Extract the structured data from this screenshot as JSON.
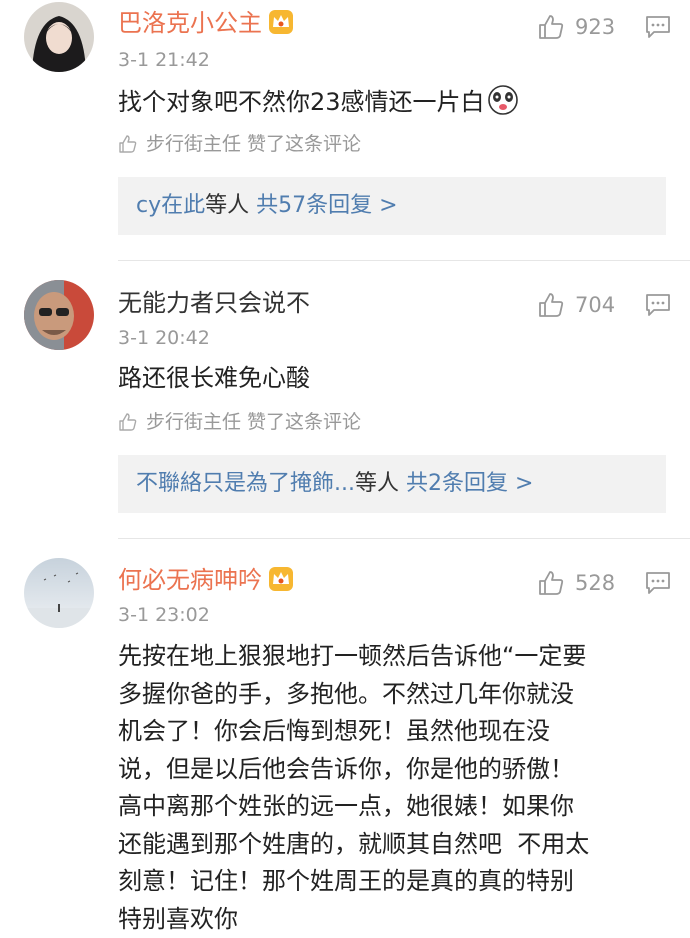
{
  "comments": [
    {
      "username": "巴洛克小公主",
      "vip": true,
      "time": "3-1 21:42",
      "text": "找个对象吧不然你23感情还一片白",
      "likes": "923",
      "liked_by": "步行街主任 赞了这条评论",
      "reply_user": "cy在此",
      "reply_mid": "等人",
      "reply_count": "共57条回复 >"
    },
    {
      "username": "无能力者只会说不",
      "vip": false,
      "time": "3-1 20:42",
      "text": "路还很长难免心酸",
      "likes": "704",
      "liked_by": "步行街主任 赞了这条评论",
      "reply_user": "不聯絡只是為了掩飾...",
      "reply_mid": "等人",
      "reply_count": "共2条回复 >"
    },
    {
      "username": "何必无病呻吟",
      "vip": true,
      "time": "3-1 23:02",
      "text_lines": [
        "先按在地上狠狠地打一顿然后告诉他“一定要",
        "多握你爸的手，多抱他。不然过几年你就没",
        "机会了！你会后悔到想死！虽然他现在没",
        "说，但是以后他会告诉你，你是他的骄傲！",
        "高中离那个姓张的远一点，她很婊！如果你",
        "还能遇到那个姓唐的，就顺其自然吧  不用太",
        "刻意！记住！那个姓周王的是真的真的特别",
        "特别喜欢你"
      ],
      "likes": "528"
    }
  ],
  "colors": {
    "vip_name": "#eb7350",
    "link": "#507daf",
    "meta": "#999999",
    "reply_bg": "#f2f2f2"
  },
  "icons": [
    "avatar",
    "crown-icon",
    "thumbs-up-icon",
    "reply-icon",
    "emoji-icon"
  ]
}
